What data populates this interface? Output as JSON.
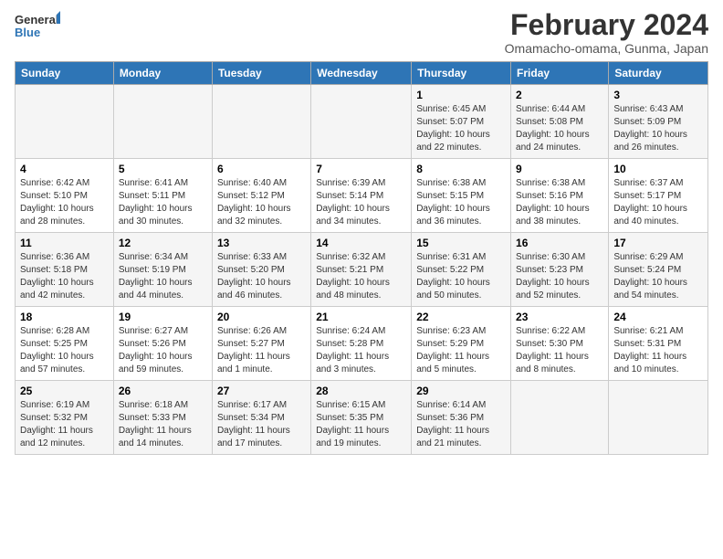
{
  "logo": {
    "line1": "General",
    "line2": "Blue"
  },
  "title": "February 2024",
  "subtitle": "Omamacho-omama, Gunma, Japan",
  "days_of_week": [
    "Sunday",
    "Monday",
    "Tuesday",
    "Wednesday",
    "Thursday",
    "Friday",
    "Saturday"
  ],
  "weeks": [
    [
      {
        "day": "",
        "info": ""
      },
      {
        "day": "",
        "info": ""
      },
      {
        "day": "",
        "info": ""
      },
      {
        "day": "",
        "info": ""
      },
      {
        "day": "1",
        "info": "Sunrise: 6:45 AM\nSunset: 5:07 PM\nDaylight: 10 hours and 22 minutes."
      },
      {
        "day": "2",
        "info": "Sunrise: 6:44 AM\nSunset: 5:08 PM\nDaylight: 10 hours and 24 minutes."
      },
      {
        "day": "3",
        "info": "Sunrise: 6:43 AM\nSunset: 5:09 PM\nDaylight: 10 hours and 26 minutes."
      }
    ],
    [
      {
        "day": "4",
        "info": "Sunrise: 6:42 AM\nSunset: 5:10 PM\nDaylight: 10 hours and 28 minutes."
      },
      {
        "day": "5",
        "info": "Sunrise: 6:41 AM\nSunset: 5:11 PM\nDaylight: 10 hours and 30 minutes."
      },
      {
        "day": "6",
        "info": "Sunrise: 6:40 AM\nSunset: 5:12 PM\nDaylight: 10 hours and 32 minutes."
      },
      {
        "day": "7",
        "info": "Sunrise: 6:39 AM\nSunset: 5:14 PM\nDaylight: 10 hours and 34 minutes."
      },
      {
        "day": "8",
        "info": "Sunrise: 6:38 AM\nSunset: 5:15 PM\nDaylight: 10 hours and 36 minutes."
      },
      {
        "day": "9",
        "info": "Sunrise: 6:38 AM\nSunset: 5:16 PM\nDaylight: 10 hours and 38 minutes."
      },
      {
        "day": "10",
        "info": "Sunrise: 6:37 AM\nSunset: 5:17 PM\nDaylight: 10 hours and 40 minutes."
      }
    ],
    [
      {
        "day": "11",
        "info": "Sunrise: 6:36 AM\nSunset: 5:18 PM\nDaylight: 10 hours and 42 minutes."
      },
      {
        "day": "12",
        "info": "Sunrise: 6:34 AM\nSunset: 5:19 PM\nDaylight: 10 hours and 44 minutes."
      },
      {
        "day": "13",
        "info": "Sunrise: 6:33 AM\nSunset: 5:20 PM\nDaylight: 10 hours and 46 minutes."
      },
      {
        "day": "14",
        "info": "Sunrise: 6:32 AM\nSunset: 5:21 PM\nDaylight: 10 hours and 48 minutes."
      },
      {
        "day": "15",
        "info": "Sunrise: 6:31 AM\nSunset: 5:22 PM\nDaylight: 10 hours and 50 minutes."
      },
      {
        "day": "16",
        "info": "Sunrise: 6:30 AM\nSunset: 5:23 PM\nDaylight: 10 hours and 52 minutes."
      },
      {
        "day": "17",
        "info": "Sunrise: 6:29 AM\nSunset: 5:24 PM\nDaylight: 10 hours and 54 minutes."
      }
    ],
    [
      {
        "day": "18",
        "info": "Sunrise: 6:28 AM\nSunset: 5:25 PM\nDaylight: 10 hours and 57 minutes."
      },
      {
        "day": "19",
        "info": "Sunrise: 6:27 AM\nSunset: 5:26 PM\nDaylight: 10 hours and 59 minutes."
      },
      {
        "day": "20",
        "info": "Sunrise: 6:26 AM\nSunset: 5:27 PM\nDaylight: 11 hours and 1 minute."
      },
      {
        "day": "21",
        "info": "Sunrise: 6:24 AM\nSunset: 5:28 PM\nDaylight: 11 hours and 3 minutes."
      },
      {
        "day": "22",
        "info": "Sunrise: 6:23 AM\nSunset: 5:29 PM\nDaylight: 11 hours and 5 minutes."
      },
      {
        "day": "23",
        "info": "Sunrise: 6:22 AM\nSunset: 5:30 PM\nDaylight: 11 hours and 8 minutes."
      },
      {
        "day": "24",
        "info": "Sunrise: 6:21 AM\nSunset: 5:31 PM\nDaylight: 11 hours and 10 minutes."
      }
    ],
    [
      {
        "day": "25",
        "info": "Sunrise: 6:19 AM\nSunset: 5:32 PM\nDaylight: 11 hours and 12 minutes."
      },
      {
        "day": "26",
        "info": "Sunrise: 6:18 AM\nSunset: 5:33 PM\nDaylight: 11 hours and 14 minutes."
      },
      {
        "day": "27",
        "info": "Sunrise: 6:17 AM\nSunset: 5:34 PM\nDaylight: 11 hours and 17 minutes."
      },
      {
        "day": "28",
        "info": "Sunrise: 6:15 AM\nSunset: 5:35 PM\nDaylight: 11 hours and 19 minutes."
      },
      {
        "day": "29",
        "info": "Sunrise: 6:14 AM\nSunset: 5:36 PM\nDaylight: 11 hours and 21 minutes."
      },
      {
        "day": "",
        "info": ""
      },
      {
        "day": "",
        "info": ""
      }
    ]
  ]
}
